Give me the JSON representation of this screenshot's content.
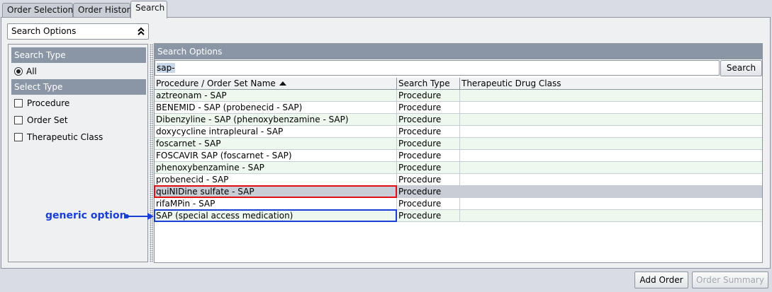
{
  "tabs": [
    {
      "label": "Order Selection",
      "active": false
    },
    {
      "label": "Order History",
      "active": false
    },
    {
      "label": "Search",
      "active": true
    }
  ],
  "search_options_dropdown": {
    "value": "Search Options",
    "icon": "double-chevron-up-icon"
  },
  "filter_panel": {
    "search_type_header": "Search Type",
    "search_type_option": {
      "label": "All",
      "selected": true
    },
    "select_type_header": "Select Type",
    "select_type_options": [
      {
        "label": "Procedure",
        "checked": false
      },
      {
        "label": "Order Set",
        "checked": false
      },
      {
        "label": "Therapeutic Class",
        "checked": false
      }
    ]
  },
  "results_panel": {
    "header": "Search Options",
    "search_input_value": "sap-",
    "search_button": "Search",
    "columns": [
      "Procedure / Order Set Name",
      "Search Type",
      "Therapeutic Drug Class"
    ],
    "sort_column": "Procedure / Order Set Name",
    "sort_direction": "ascending",
    "rows": [
      {
        "name": "aztreonam - SAP",
        "type": "Procedure",
        "class": ""
      },
      {
        "name": "BENEMID - SAP (probenecid - SAP)",
        "type": "Procedure",
        "class": ""
      },
      {
        "name": "Dibenzyline - SAP (phenoxybenzamine - SAP)",
        "type": "Procedure",
        "class": ""
      },
      {
        "name": "doxycycline intrapleural - SAP",
        "type": "Procedure",
        "class": ""
      },
      {
        "name": "foscarnet - SAP",
        "type": "Procedure",
        "class": ""
      },
      {
        "name": "FOSCAVIR SAP (foscarnet - SAP)",
        "type": "Procedure",
        "class": ""
      },
      {
        "name": "phenoxybenzamine - SAP",
        "type": "Procedure",
        "class": ""
      },
      {
        "name": "probenecid - SAP",
        "type": "Procedure",
        "class": ""
      },
      {
        "name": "quiNIDine sulfate - SAP",
        "type": "Procedure",
        "class": "",
        "selected": true
      },
      {
        "name": "rifaMPin - SAP",
        "type": "Procedure",
        "class": ""
      },
      {
        "name": "SAP (special access medication)",
        "type": "Procedure",
        "class": ""
      }
    ]
  },
  "annotation": {
    "text": "generic option",
    "color": "#1a3fd8"
  },
  "buttons": {
    "add_order": "Add Order",
    "order_summary": "Order Summary"
  },
  "colors": {
    "section_header": "#8a96a6",
    "highlight_red": "#e01010",
    "highlight_blue": "#1a3fd8",
    "row_alt": "#edf8ee"
  }
}
